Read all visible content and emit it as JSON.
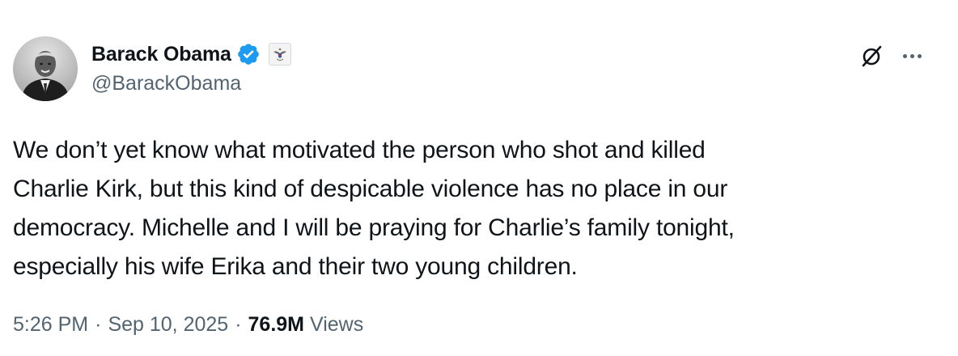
{
  "author": {
    "display_name": "Barack Obama",
    "handle": "@BarackObama",
    "verified_badge_color": "#1d9bf0",
    "avatar_icon": "profile-photo",
    "affiliation_icon": "government-seal-icon"
  },
  "header_actions": {
    "grok_icon": "grok-icon",
    "more_icon": "more-icon"
  },
  "tweet": {
    "text_lines": [
      "We don’t yet know what motivated the person who shot and killed",
      "Charlie Kirk, but this kind of despicable violence has no place in our",
      "democracy. Michelle and I will be praying for Charlie’s family tonight,",
      "especially his wife Erika and their two young children."
    ]
  },
  "meta": {
    "time": "5:26 PM",
    "separator": "·",
    "date": "Sep 10, 2025",
    "views_count": "76.9M",
    "views_label": "Views"
  },
  "colors": {
    "text_primary": "#0f1419",
    "text_secondary": "#536471",
    "verified_blue": "#1d9bf0"
  }
}
